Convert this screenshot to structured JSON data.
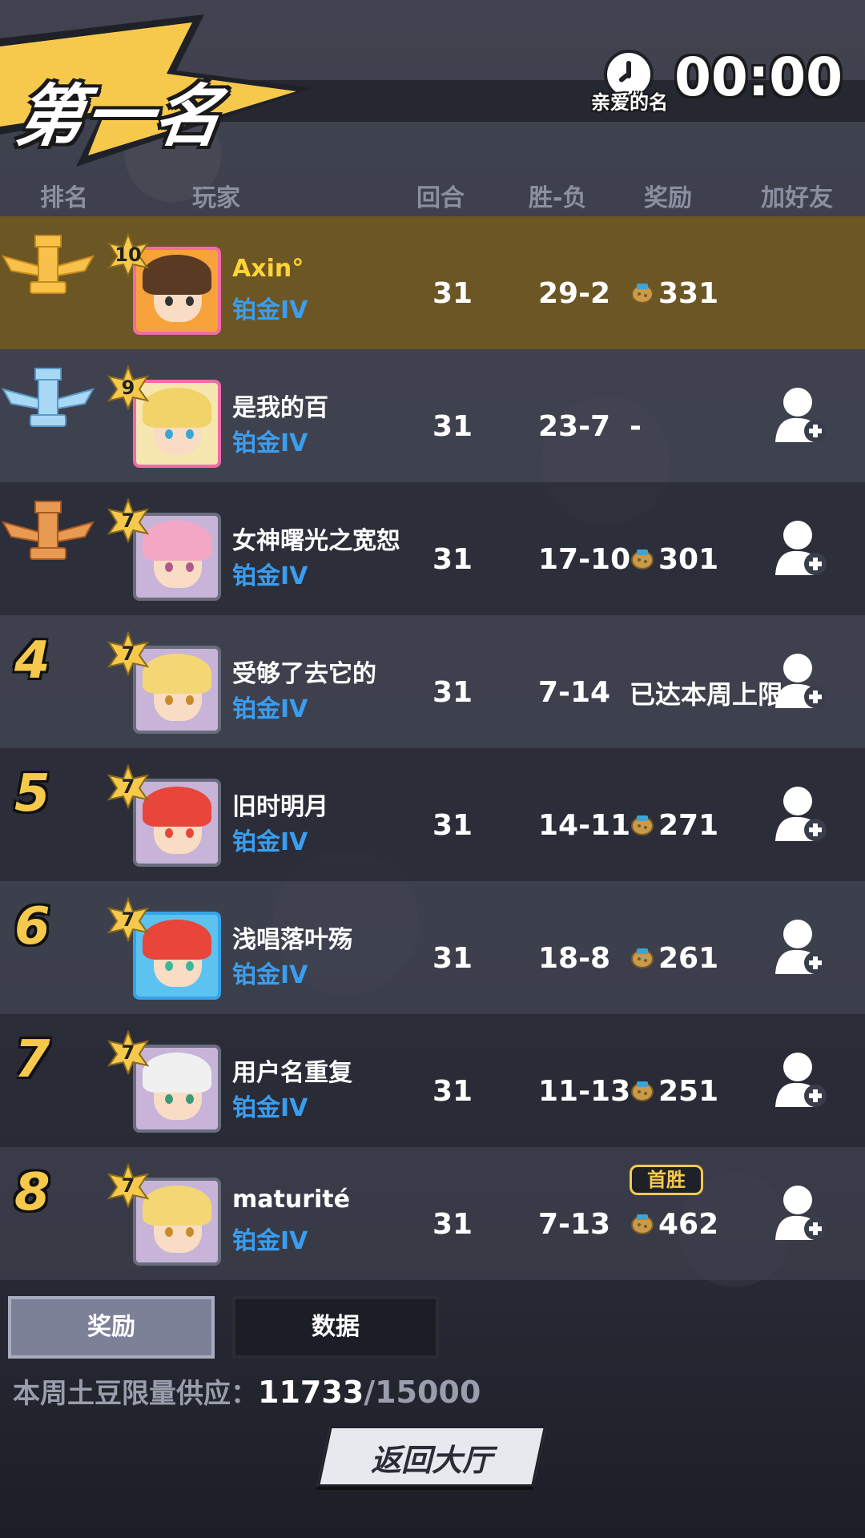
{
  "header": {
    "title": "第一名",
    "timer": "00:00",
    "timer_sub": "亲爱的名"
  },
  "columns": {
    "rank": "排名",
    "player": "玩家",
    "rounds": "回合",
    "win_loss": "胜-负",
    "reward": "奖励",
    "add_friend": "加好友"
  },
  "rows": [
    {
      "rank": "1",
      "level": "10",
      "name": "Axin°",
      "tier": "铂金IV",
      "rounds": "31",
      "wl": "29-2",
      "reward": "331"
    },
    {
      "rank": "2",
      "level": "9",
      "name": "是我的百",
      "tier": "铂金IV",
      "rounds": "31",
      "wl": "23-7",
      "reward": "-"
    },
    {
      "rank": "3",
      "level": "7",
      "name": "女神曙光之宽恕",
      "tier": "铂金IV",
      "rounds": "31",
      "wl": "17-10",
      "reward": "301"
    },
    {
      "rank": "4",
      "level": "7",
      "name": "受够了去它的",
      "tier": "铂金IV",
      "rounds": "31",
      "wl": "7-14",
      "reward": "已达本周上限"
    },
    {
      "rank": "5",
      "level": "7",
      "name": "旧时明月",
      "tier": "铂金IV",
      "rounds": "31",
      "wl": "14-11",
      "reward": "271"
    },
    {
      "rank": "6",
      "level": "7",
      "name": "浅唱落叶殇",
      "tier": "铂金IV",
      "rounds": "31",
      "wl": "18-8",
      "reward": "261"
    },
    {
      "rank": "7",
      "level": "7",
      "name": "用户名重复",
      "tier": "铂金IV",
      "rounds": "31",
      "wl": "11-13",
      "reward": "251"
    },
    {
      "rank": "8",
      "level": "7",
      "name": "maturité",
      "tier": "铂金IV",
      "rounds": "31",
      "wl": "7-13",
      "reward": "462",
      "badge": "首胜"
    }
  ],
  "tabs": {
    "reward": "奖励",
    "data": "数据"
  },
  "supply": {
    "label": "本周土豆限量供应：",
    "current": "11733",
    "max": "/15000"
  },
  "return_button": "返回大厅",
  "colors": {
    "gold": "#f6c94c",
    "tier_blue": "#3a9ef0",
    "highlight_row": "#6b5624"
  }
}
